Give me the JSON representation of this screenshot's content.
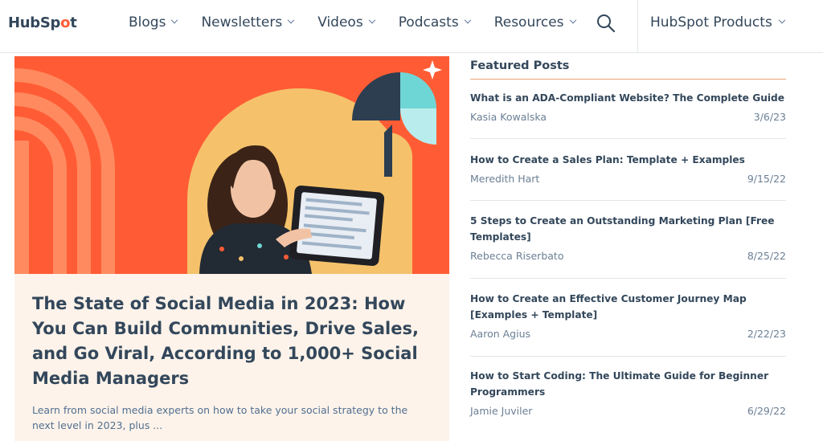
{
  "brand": {
    "logo_text_left": "HubSp",
    "logo_text_sprocket": "o",
    "logo_text_right": "t"
  },
  "nav": {
    "items": [
      {
        "label": "Blogs"
      },
      {
        "label": "Newsletters"
      },
      {
        "label": "Videos"
      },
      {
        "label": "Podcasts"
      },
      {
        "label": "Resources"
      }
    ],
    "products_label": "HubSpot Products"
  },
  "hero": {
    "title": "The State of Social Media in 2023: How You Can Build Communities, Drive Sales, and Go Viral, According to 1,000+ Social Media Managers",
    "excerpt": "Learn from social media experts on how to take your social strategy to the next level in 2023, plus ..."
  },
  "featured": {
    "heading": "Featured Posts",
    "posts": [
      {
        "title": "What is an ADA-Compliant Website? The Complete Guide",
        "author": "Kasia Kowalska",
        "date": "3/6/23"
      },
      {
        "title": "How to Create a Sales Plan: Template + Examples",
        "author": "Meredith Hart",
        "date": "9/15/22"
      },
      {
        "title": "5 Steps to Create an Outstanding Marketing Plan [Free Templates]",
        "author": "Rebecca Riserbato",
        "date": "8/25/22"
      },
      {
        "title": "How to Create an Effective Customer Journey Map [Examples + Template]",
        "author": "Aaron Agius",
        "date": "2/22/23"
      },
      {
        "title": "How to Start Coding: The Ultimate Guide for Beginner Programmers",
        "author": "Jamie Juviler",
        "date": "6/29/22"
      }
    ]
  },
  "colors": {
    "accent": "#ff5c35",
    "text": "#33475b",
    "card_bg": "#fdf3ea",
    "yellow": "#f5c26b",
    "teal": "#6fd6d6"
  },
  "icons": {
    "search": "search-icon",
    "chevron": "chevron-down-icon"
  }
}
